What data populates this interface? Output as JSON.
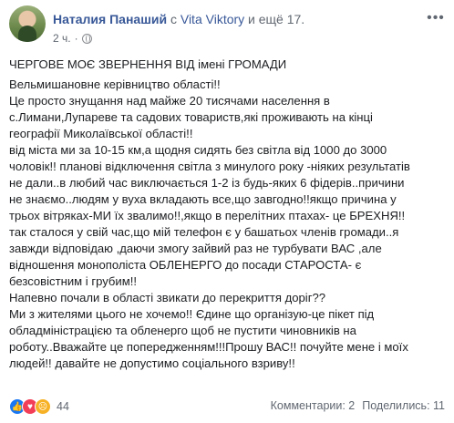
{
  "post": {
    "author": "Наталия Панаший",
    "with_word": "с",
    "tagged": "Vita Viktory",
    "and_more": "и ещё 17.",
    "time": "2 ч.",
    "title": "ЧЕРГОВЕ МОЄ ЗВЕРНЕННЯ ВІД імені ГРОМАДИ",
    "body": "Вельмишановне керівництво області!!\nЦе просто знущання над майже 20 тисячами населення в\nс.Лимани,Лупареве та садових товариств,які проживають на кінці\nгеографії Миколаївської області!!\nвід міста ми за 10-15 км,а щодня сидять без світла від 1000 до 3000\nчоловік!! планові відключення світла з минулого року -ніяких результатів\nне дали..в любий час виключається 1-2 із будь-яких 6 фідерів..причини\nне знаємо..людям у вуха вкладають все,що завгодно!!якщо причина у\nтрьох вітряках-МИ їх звалимо!!,якщо в перелітних птахах- це БРЕХНЯ!!\nтак сталося у свій час,що мій телефон є у башатьох членів громади..я\nзавжди відповідаю ,даючи змогу зайвий раз не турбувати ВАС ,але\nвідношення монополіста ОБЛЕНЕРГО до посади СТАРОСТА- є\nбезсовістним і грубим!!\nНапевно почали в області звикати до перекриття доріг??\nМи з жителями цього не хочемо!! Єдине що організую-це пікет під\nобладміністрацією та обленерго щоб не пустити чиновників на\nроботу..Вважайте це попередженням!!!Прошу ВАС!! почуйте мене і моїх\nлюдей!! давайте не допустимо соціального взриву!!"
  },
  "footer": {
    "reaction_count": "44",
    "comments": "Комментарии: 2",
    "shares": "Поделились: 11",
    "reaction_icons": [
      "like-icon",
      "love-icon",
      "angry-icon"
    ]
  },
  "colors": {
    "link": "#385898",
    "text": "#1c1e21",
    "muted": "#606770",
    "like": "#1877f2",
    "love": "#f33e58",
    "angry": "#f7b125"
  }
}
